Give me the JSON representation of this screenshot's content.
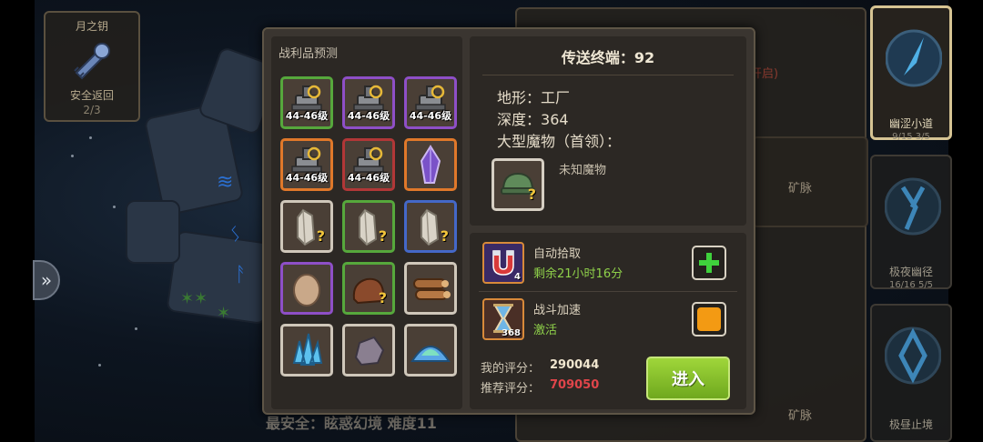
{
  "left_card": {
    "title": "月之钥",
    "subtitle": "安全返回",
    "count": "2/3"
  },
  "loot": {
    "title": "战利品预测",
    "items": [
      {
        "level": "44-46级",
        "rarity": "green",
        "icon": "turret-icon",
        "unknown": false
      },
      {
        "level": "44-46级",
        "rarity": "purple",
        "icon": "turret-icon",
        "unknown": false
      },
      {
        "level": "44-46级",
        "rarity": "purple",
        "icon": "turret-icon",
        "unknown": false
      },
      {
        "level": "44-46级",
        "rarity": "orange",
        "icon": "turret-icon",
        "unknown": false
      },
      {
        "level": "44-46级",
        "rarity": "red",
        "icon": "turret-icon",
        "unknown": false
      },
      {
        "level": "",
        "rarity": "orange",
        "icon": "purple-crystal-icon",
        "unknown": false
      },
      {
        "level": "",
        "rarity": "white",
        "icon": "clear-crystal-icon",
        "unknown": true
      },
      {
        "level": "",
        "rarity": "green",
        "icon": "clear-crystal-icon",
        "unknown": true
      },
      {
        "level": "",
        "rarity": "blue",
        "icon": "clear-crystal-icon",
        "unknown": true
      },
      {
        "level": "",
        "rarity": "purple",
        "icon": "egg-icon",
        "unknown": false
      },
      {
        "level": "",
        "rarity": "green",
        "icon": "beast-icon",
        "unknown": true
      },
      {
        "level": "",
        "rarity": "white",
        "icon": "logs-icon",
        "unknown": false
      },
      {
        "level": "",
        "rarity": "white",
        "icon": "blue-crystal-cluster-icon",
        "unknown": false
      },
      {
        "level": "",
        "rarity": "white",
        "icon": "stone-icon",
        "unknown": false
      },
      {
        "level": "",
        "rarity": "white",
        "icon": "crystal-powder-icon",
        "unknown": false
      }
    ]
  },
  "info": {
    "terminal_label": "传送终端：",
    "terminal_value": "92",
    "terrain_label": "地形：",
    "terrain_value": "工厂",
    "depth_label": "深度：",
    "depth_value": "364",
    "boss_label": "大型魔物（首领）：",
    "monster_name": "未知魔物"
  },
  "buffs": [
    {
      "name": "自动拾取",
      "status": "剩余21小时16分",
      "count": "4",
      "icon": "magnet-icon",
      "button": "plus-button"
    },
    {
      "name": "战斗加速",
      "status": "激活",
      "count": "368",
      "icon": "hourglass-icon",
      "button": "orange-toggle"
    }
  ],
  "scores": {
    "mine_label": "我的评分：",
    "mine_value": "290044",
    "recommended_label": "推荐评分：",
    "recommended_value": "709050"
  },
  "enter_label": "进入",
  "bottom_hint": "最安全：眩惑幻境 难度11",
  "right_maps": [
    {
      "name": "幽涩小道",
      "stats": "9/15  3/5",
      "active": true
    },
    {
      "name": "极夜幽径",
      "stats": "16/16  5/5",
      "active": false
    },
    {
      "name": "极昼止境",
      "stats": "",
      "active": false
    }
  ],
  "background_texts": {
    "ore1": "矿脉",
    "ore2": "矿脉",
    "open_hint": "开启)"
  },
  "colors": {
    "score_mine": "#f0e6cf",
    "score_recommended": "#e0454a",
    "buff_status": "#8fd14a",
    "enter_button": "#8cc52c"
  }
}
